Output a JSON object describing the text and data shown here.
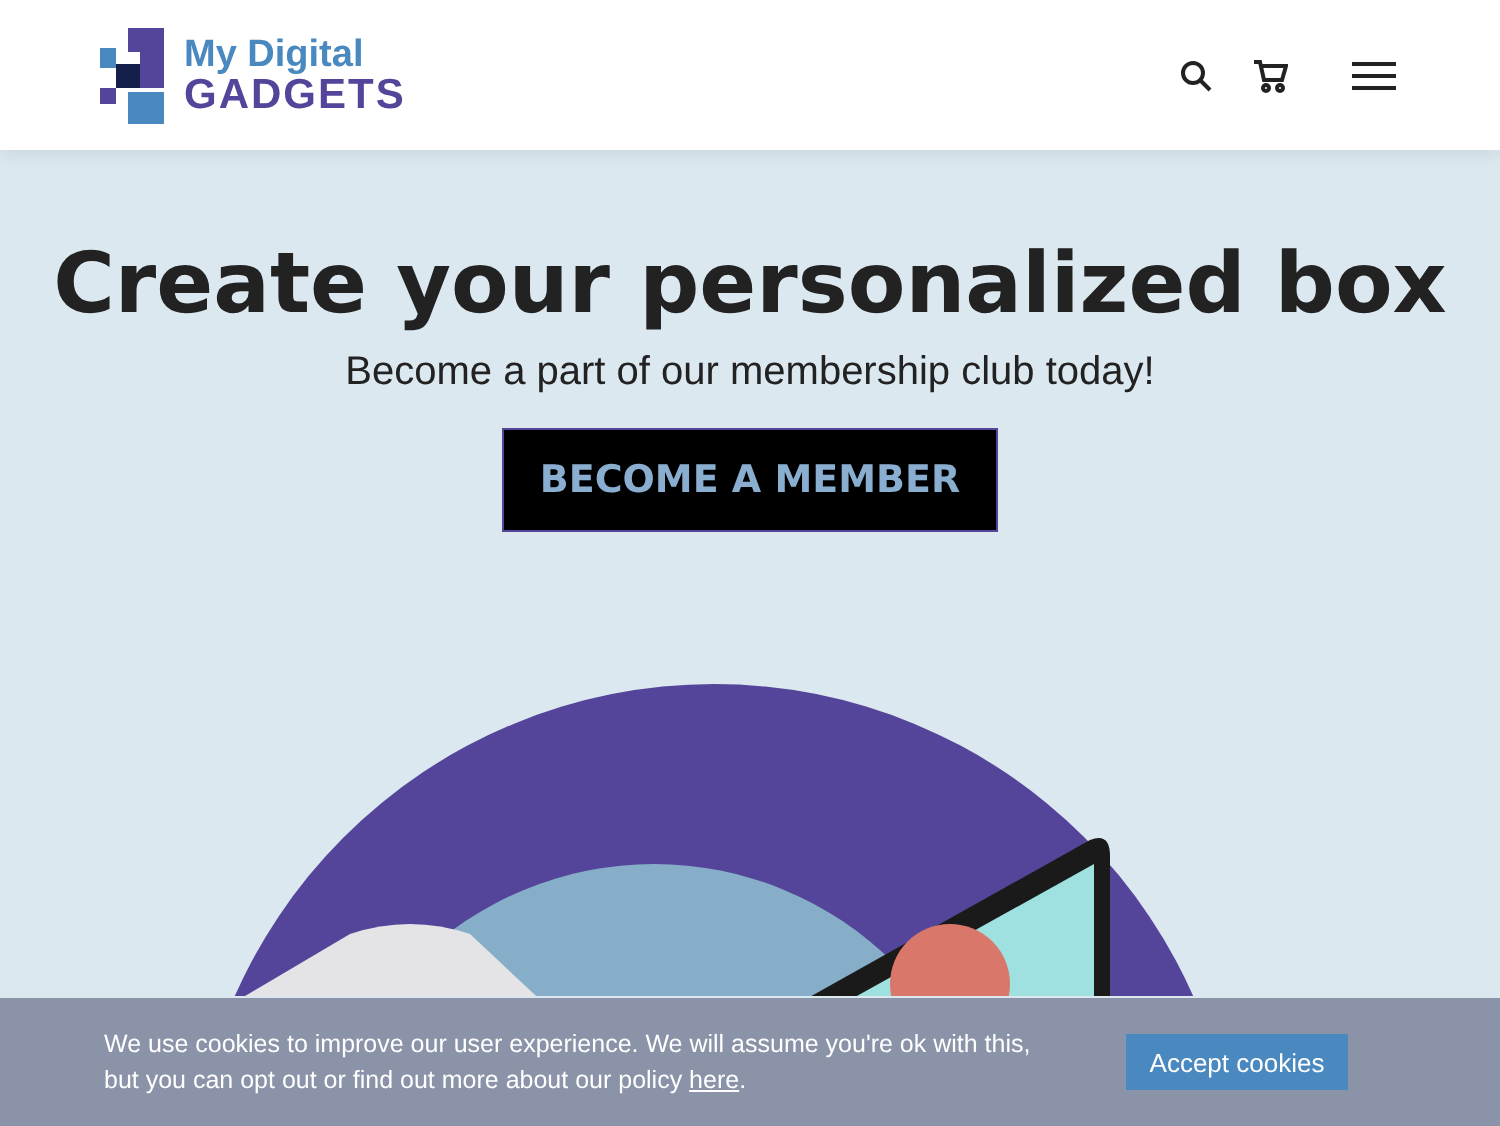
{
  "header": {
    "logo": {
      "line_1": "My Digital",
      "line_2": "GADGETS"
    }
  },
  "hero": {
    "title": "Create your personalized box",
    "subtitle": "Become a part of our membership club today!",
    "button": "BECOME A MEMBER"
  },
  "cookie_banner": {
    "text": "We use cookies to improve our user experience. We will assume you're ok with this, but you can opt out or find out more about our policy ",
    "link": "here",
    "text_end": ".",
    "button": "Accept cookies"
  }
}
